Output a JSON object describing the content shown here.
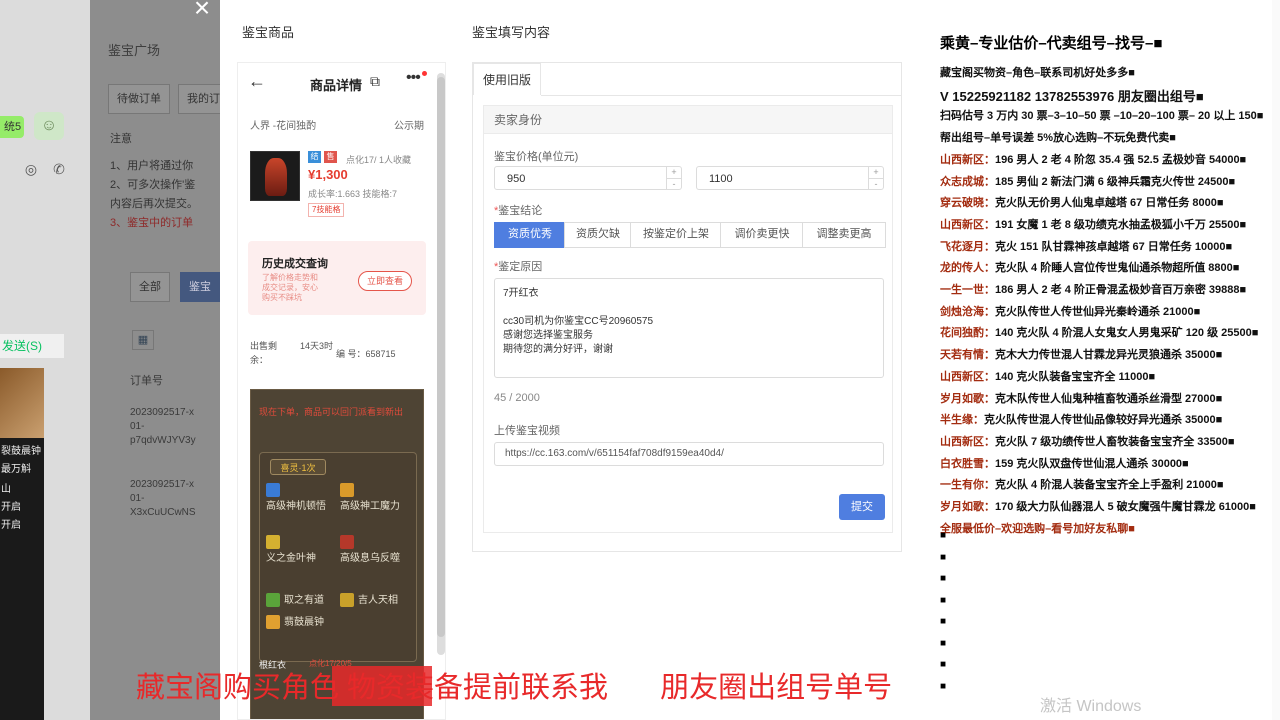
{
  "left_chat": {
    "bubble_text": "统5",
    "send_label": "发送(S)",
    "video_lines": [
      "裂鼓晨钟",
      "最万斛",
      "山",
      "开启",
      "开启"
    ]
  },
  "background_page": {
    "title": "鉴宝广场",
    "tabs": [
      "待做订单",
      "我的订单"
    ],
    "notice_title": "注意",
    "notice_lines": [
      "1、用户将通过你",
      "2、可多次操作'鉴",
      "内容后再次提交。",
      "3、鉴宝中的订单"
    ],
    "chips": [
      "全部",
      "鉴宝"
    ],
    "table_header": "订单号",
    "rows": [
      [
        "2023092517-x",
        "01-",
        "p7qdvWJYV3y"
      ],
      [
        "2023092517-x",
        "01-",
        "X3xCuUCwNS"
      ]
    ]
  },
  "modal": {
    "goods_header": "鉴宝商品",
    "fill_header": "鉴宝填写内容"
  },
  "phone": {
    "nav_title": "商品详情",
    "server": "人界 -花间独酌",
    "status": "公示期",
    "tag1": "结",
    "tag2": "售",
    "fav_text": "点化17/ 1人收藏",
    "price": "¥1,300",
    "growth_text": "成长率:1.663 技能格:7",
    "badge": "7技能格",
    "history_title": "历史成交查询",
    "history_desc": "了解价格走势和成交记录，安心购买不踩坑",
    "history_button": "立即查看",
    "sale_left_label": "出售剩余：",
    "sale_left_value": "14天3时",
    "serial": "编 号：658715",
    "game_warning": "现在下单，商品可以回门派看到新出",
    "skills_box_title": "喜灵·1次",
    "skills": [
      "高级神机顿悟",
      "高级神工魔力",
      "义之金叶神",
      "高级息乌反噬",
      "取之有道",
      "吉人天相",
      "翡鼓晨钟"
    ],
    "bottom_left": "根红衣",
    "bottom_right": "点化17/20/5"
  },
  "form": {
    "tab_label": "使用旧版",
    "section_title": "卖家身份",
    "price_label": "鉴宝价格(单位元)",
    "price_min": "950",
    "price_max": "1100",
    "conclusion_label": "鉴宝结论",
    "conclusion_options": [
      "资质优秀",
      "资质欠缺",
      "按鉴定价上架",
      "调价卖更快",
      "调整卖更高"
    ],
    "conclusion_selected": "资质优秀",
    "reason_label": "鉴定原因",
    "reason_text": "7开红衣\n\ncc30司机为你鉴宝CC号20960575\n感谢您选择鉴宝服务\n期待您的满分好评，谢谢",
    "char_count": "45 / 2000",
    "video_label": "上传鉴宝视频",
    "video_url": "https://cc.163.com/v/651154faf708df9159ea40d4/",
    "submit_label": "提交",
    "accent_color": "#4f7ee0"
  },
  "right_panel": {
    "title": "乘黄–专业估价–代卖组号–找号–■",
    "lines": [
      {
        "k": "",
        "v": "藏宝阁买物资–角色–联系司机好处多多■"
      },
      {
        "k": "",
        "v": "V 15225921182   13782553976 朋友圈出组号■"
      },
      {
        "k": "",
        "v": "扫码估号 3 万内 30 票–3–10–50 票 –10–20–100 票– 20 以上 150■"
      },
      {
        "k": "",
        "v": "帮出组号–单号误差 5%放心选购–不玩免费代卖■"
      },
      {
        "k": "山西新区：",
        "v": "196 男人 2 老 4 阶忽 35.4 强 52.5 孟极妙音 54000■"
      },
      {
        "k": "众志成城：",
        "v": "185 男仙 2 新法门满 6 级神兵霜克火传世 24500■"
      },
      {
        "k": "穿云破晓：",
        "v": "克火队无价男人仙鬼卓越塔 67 日常任务 8000■"
      },
      {
        "k": "山西新区：",
        "v": "191 女魔 1 老 8 级功绩克水抽孟极狐小千万 25500■"
      },
      {
        "k": "飞花逐月：",
        "v": "克火 151 队甘霖神孩卓越塔 67 日常任务 10000■"
      },
      {
        "k": "龙的传人：",
        "v": "克火队 4 阶睡人宫位传世鬼仙通杀物超所值 8800■"
      },
      {
        "k": "一生一世：",
        "v": "186 男人 2 老 4 阶正骨混孟极妙音百万亲密 39888■"
      },
      {
        "k": "剑烛沧海：",
        "v": "克火队传世人传世仙异光秦岭通杀 21000■"
      },
      {
        "k": "花间独酌：",
        "v": "140 克火队 4 阶混人女鬼女人男鬼采矿 120 级 25500■"
      },
      {
        "k": "天若有情：",
        "v": "克木大力传世混人甘霖龙异光灵狼通杀 35000■"
      },
      {
        "k": "山西新区：",
        "v": "140 克火队装备宝宝齐全 11000■"
      },
      {
        "k": "岁月如歌：",
        "v": "克木队传世人仙鬼种植畜牧通杀丝滑型 27000■"
      },
      {
        "k": "半生缘：",
        "v": "克火队传世混人传世仙品像较好异光通杀 35000■"
      },
      {
        "k": "山西新区：",
        "v": "克火队 7 级功绩传世人畜牧装备宝宝齐全 33500■"
      },
      {
        "k": "白衣胜雪：",
        "v": "159 克火队双盘传世仙混人通杀 30000■"
      },
      {
        "k": "一生有你：",
        "v": "克火队 4 阶混人装备宝宝齐全上手盈利 21000■"
      },
      {
        "k": "岁月如歌：",
        "v": "170 级大力队仙器混人 5 破女魔强牛魔甘霖龙 61000■"
      },
      {
        "k": "",
        "v": "全服最低价–欢迎选购–看号加好友私聊■"
      }
    ],
    "bullets": [
      "■",
      "■",
      "■",
      "■",
      "■",
      "■",
      "■",
      "■"
    ]
  },
  "overlay": {
    "left": "藏宝阁购买角色  物资装备提前联系我",
    "right": "朋友圈出组号单号"
  },
  "watermark": "激活 Windows"
}
